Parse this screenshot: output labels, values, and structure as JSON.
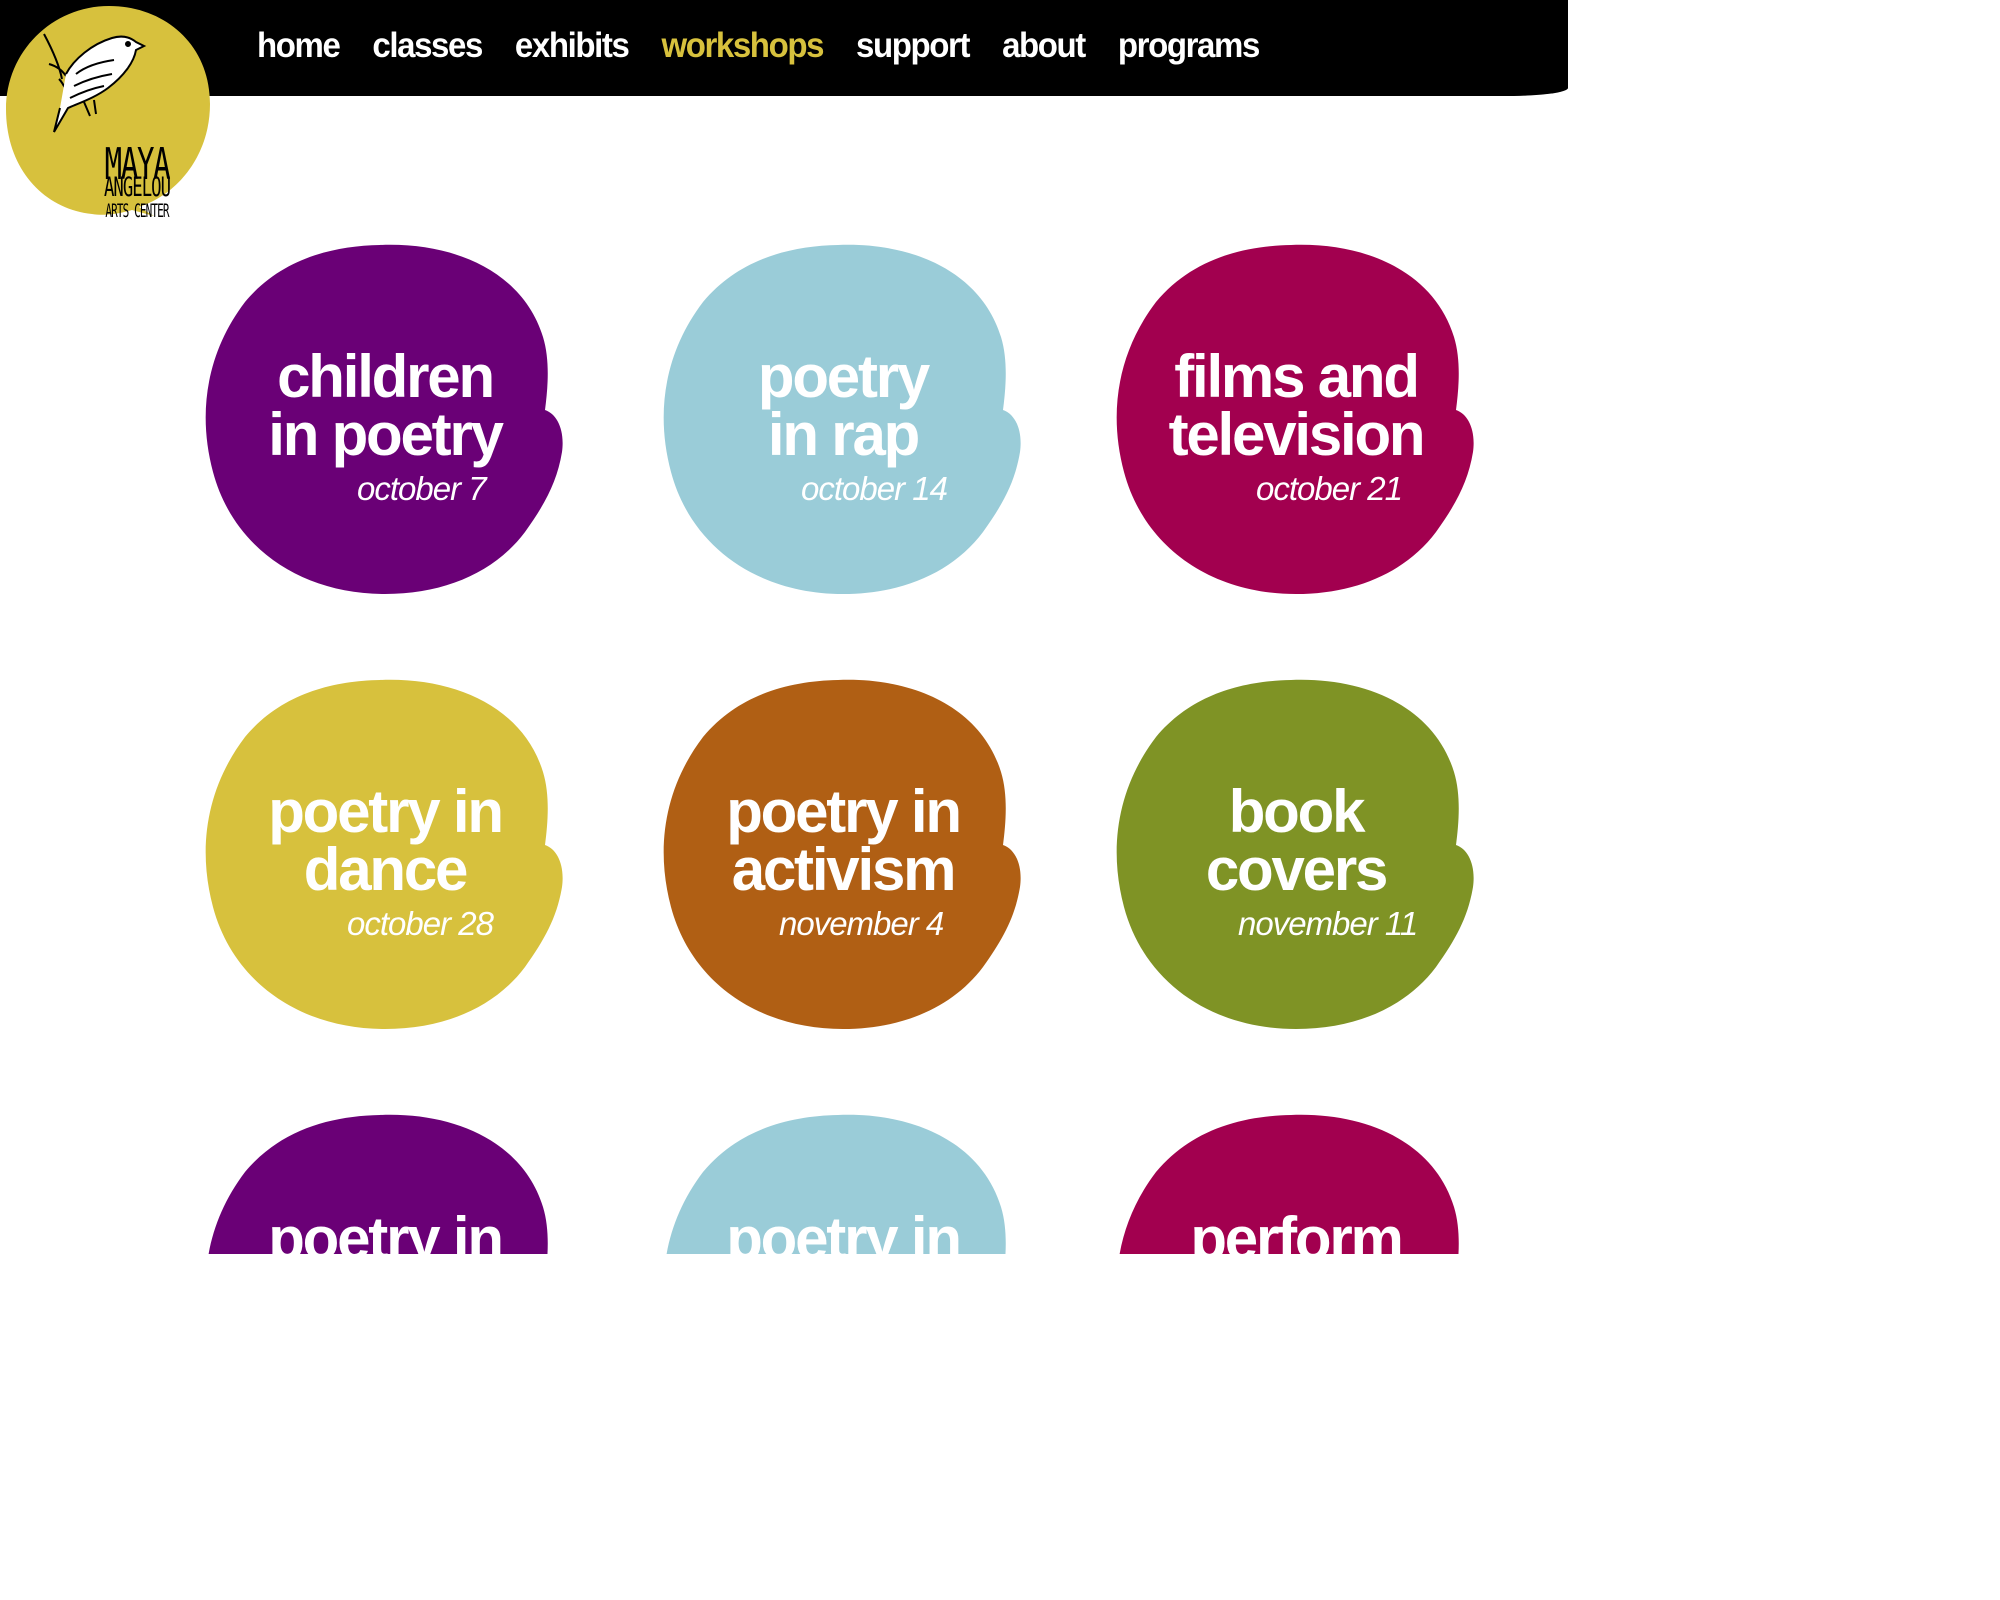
{
  "nav": {
    "items": [
      {
        "label": "home"
      },
      {
        "label": "classes"
      },
      {
        "label": "exhibits"
      },
      {
        "label": "workshops",
        "active": true
      },
      {
        "label": "support"
      },
      {
        "label": "about"
      },
      {
        "label": "programs"
      }
    ]
  },
  "logo": {
    "line1": "MAYA",
    "line2": "ANGELOU",
    "line3": "ARTS CENTER",
    "color": "#D7C13D"
  },
  "colors": {
    "purple": "#6A0076",
    "lightblue": "#9ACCD8",
    "magenta": "#A2004F",
    "mustard": "#D7C13D",
    "rust": "#B05F14",
    "olive": "#7F9325",
    "accent": "#D7C13D"
  },
  "workshops": [
    {
      "title": "children\nin poetry",
      "date": "october 7",
      "color": "#6A0076"
    },
    {
      "title": "poetry\nin rap",
      "date": "october 14",
      "color": "#9ACCD8"
    },
    {
      "title": "films and\ntelevision",
      "date": "october 21",
      "color": "#A2004F"
    },
    {
      "title": "poetry in\ndance",
      "date": "october 28",
      "color": "#D7C13D"
    },
    {
      "title": "poetry in\nactivism",
      "date": "november 4",
      "color": "#B05F14"
    },
    {
      "title": "book\ncovers",
      "date": "november 11",
      "color": "#7F9325"
    },
    {
      "title": "poetry in",
      "date": "",
      "color": "#6A0076"
    },
    {
      "title": "poetry in",
      "date": "",
      "color": "#9ACCD8"
    },
    {
      "title": "perform",
      "date": "",
      "color": "#A2004F"
    }
  ]
}
